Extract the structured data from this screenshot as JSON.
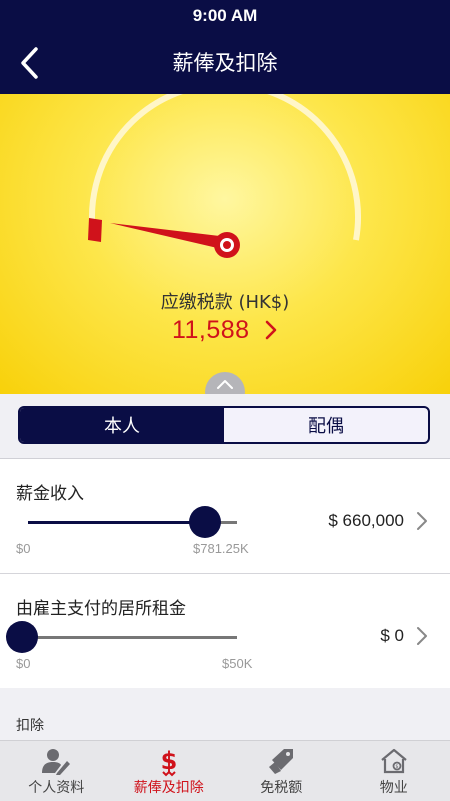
{
  "status_bar": {
    "time": "9:00 AM"
  },
  "nav": {
    "title": "薪俸及扣除"
  },
  "gauge": {
    "level": 0.03
  },
  "tax": {
    "label": "应缴税款 (HK$)",
    "value": "11,588"
  },
  "segment": {
    "items": [
      {
        "label": "本人",
        "active": true
      },
      {
        "label": "配偶",
        "active": false
      }
    ]
  },
  "salary": {
    "title": "薪金收入",
    "min_label": "$0",
    "max_label": "$781.25K",
    "value": "$ 660,000",
    "level": 0.845
  },
  "rent": {
    "title": "由雇主支付的居所租金",
    "min_label": "$0",
    "max_label": "$50K",
    "value": "$ 0",
    "level": 0.0
  },
  "deductions": {
    "label": "扣除"
  },
  "tabbar": {
    "items": [
      {
        "label": "个人资料",
        "icon": "person-edit-icon"
      },
      {
        "label": "薪俸及扣除",
        "icon": "dollar-icon",
        "active": true
      },
      {
        "label": "免税额",
        "icon": "tag-icon"
      },
      {
        "label": "物业",
        "icon": "house-icon"
      }
    ]
  },
  "colors": {
    "navy": "#0a0d45",
    "accent_red": "#d0121b",
    "hero_yellow": "#fde64a"
  }
}
